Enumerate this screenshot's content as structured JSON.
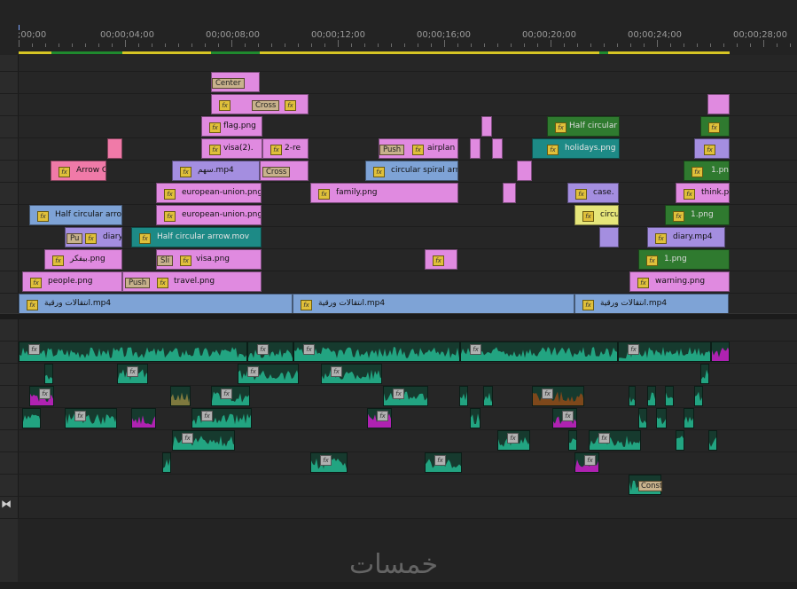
{
  "ruler": {
    "ticks": [
      {
        "label": ";00;00"
      },
      {
        "label": "00;00;04;00"
      },
      {
        "label": "00;00;08;00"
      },
      {
        "label": "00;00;12;00"
      },
      {
        "label": "00;00;16;00"
      },
      {
        "label": "00;00;20;00"
      },
      {
        "label": "00;00;24;00"
      },
      {
        "label": "00;00;28;00"
      }
    ]
  },
  "colors": {
    "pink": "#e08ae0",
    "violet": "#a48ee0",
    "blue": "#7ea3d6",
    "teal": "#1d8a86",
    "green": "#2f7a2f",
    "rose": "#f07aa8",
    "yellow": "#e6e67a",
    "audio_green": "#24b08a",
    "audio_magenta": "#c020c0",
    "audio_olive": "#8a8040",
    "audio_brown": "#8a4a1a",
    "workarea": "#d6c524"
  },
  "video_clips": [
    {
      "id": "v_center",
      "label": "Center"
    },
    {
      "id": "v_fx_a",
      "label": ""
    },
    {
      "id": "v_cross_a",
      "label": "Cross"
    },
    {
      "id": "v_flag",
      "label": "flag.png"
    },
    {
      "id": "v_half_circ_top",
      "label": "Half circular"
    },
    {
      "id": "v_visa2",
      "label": "visa(2)."
    },
    {
      "id": "v_2re",
      "label": "2-re"
    },
    {
      "id": "v_push_a",
      "label": "Push"
    },
    {
      "id": "v_airplan",
      "label": "airplan"
    },
    {
      "id": "v_holidays",
      "label": "holidays.png"
    },
    {
      "id": "v_arrowc",
      "label": "Arrow C"
    },
    {
      "id": "v_sahm",
      "label": "سهم.mp4"
    },
    {
      "id": "v_cross_b",
      "label": "Cross"
    },
    {
      "id": "v_circular_spiral",
      "label": "circular spiral arro"
    },
    {
      "id": "v_1pn",
      "label": "1.pn"
    },
    {
      "id": "v_eu1",
      "label": "european-union.png"
    },
    {
      "id": "v_family",
      "label": "family.png"
    },
    {
      "id": "v_case",
      "label": "case."
    },
    {
      "id": "v_think",
      "label": "think.p"
    },
    {
      "id": "v_half_circ_arro",
      "label": "Half circular arro"
    },
    {
      "id": "v_eu2",
      "label": "european-union.png"
    },
    {
      "id": "v_circu",
      "label": "circu"
    },
    {
      "id": "v_1png_a",
      "label": "1.png"
    },
    {
      "id": "v_pu",
      "label": "Pu"
    },
    {
      "id": "v_diary",
      "label": "diary"
    },
    {
      "id": "v_half_circ_mov",
      "label": "Half circular arrow.mov"
    },
    {
      "id": "v_diary_mp4",
      "label": "diary.mp4"
    },
    {
      "id": "v_bifkr",
      "label": "بيفكر.png"
    },
    {
      "id": "v_sli",
      "label": "Sli"
    },
    {
      "id": "v_visa",
      "label": "visa.png"
    },
    {
      "id": "v_1png_b",
      "label": "1.png"
    },
    {
      "id": "v_people",
      "label": "people.png"
    },
    {
      "id": "v_push_b",
      "label": "Push"
    },
    {
      "id": "v_travel",
      "label": "travel.png"
    },
    {
      "id": "v_warning",
      "label": "warning.png"
    },
    {
      "id": "v_base1",
      "label": "انتقالات ورقية.mp4"
    },
    {
      "id": "v_base2",
      "label": "انتقالات ورقية.mp4"
    },
    {
      "id": "v_base3",
      "label": "انتقالات ورقية.mp4"
    }
  ],
  "audio": {
    "constant_label": "Consta"
  },
  "watermark": "خمسات",
  "icons": {
    "fx": "fx-icon",
    "zoom": "zoom-handle-icon"
  }
}
